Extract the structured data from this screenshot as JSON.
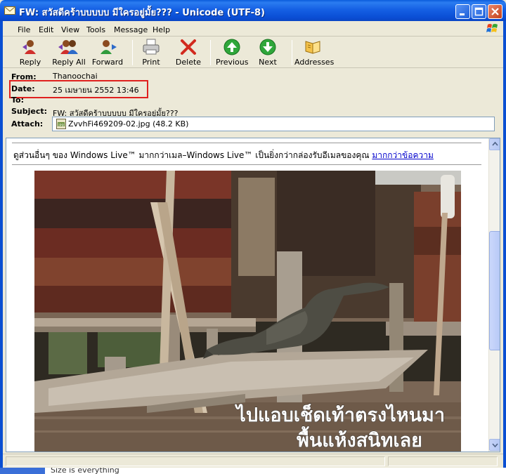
{
  "window": {
    "title": "FW: สวัสดีคร้าบบบบบ มีใครอยู่มั้ย??? - Unicode (UTF-8)"
  },
  "menu": {
    "items": [
      "File",
      "Edit",
      "View",
      "Tools",
      "Message",
      "Help"
    ]
  },
  "toolbar": {
    "reply": "Reply",
    "reply_all": "Reply All",
    "forward": "Forward",
    "print": "Print",
    "delete": "Delete",
    "previous": "Previous",
    "next": "Next",
    "addresses": "Addresses"
  },
  "headers": {
    "from_label": "From:",
    "from_value": "Thanoochai",
    "date_label": "Date:",
    "date_value": "25 เมษายน 2552 13:46",
    "to_label": "To:",
    "subject_label": "Subject:",
    "subject_value": "FW: สวัสดีคร้าบบบบบ มีใครอยู่มั้ย???",
    "attach_label": "Attach:",
    "attach_value": "ZvvhFi469209-02.jpg (48.2 KB)"
  },
  "body": {
    "promo_text": "ดูส่วนอื่นๆ ของ Windows Live™ มากกว่าเมล–Windows Live™ เป็นยิ่งกว่ากล่องรับอีเมลของคุณ",
    "promo_link": "มากกว่าข้อความ",
    "caption_line1": "ไปแอบเช็ดเท้าตรงไหนมา",
    "caption_line2": "พื้นแห้งสนิทเลย"
  },
  "taskbar": {
    "text": "Size is everything"
  },
  "colors": {
    "title_bar": "#0b55d8",
    "date_highlight": "#e0201e",
    "link": "#0000cc"
  }
}
